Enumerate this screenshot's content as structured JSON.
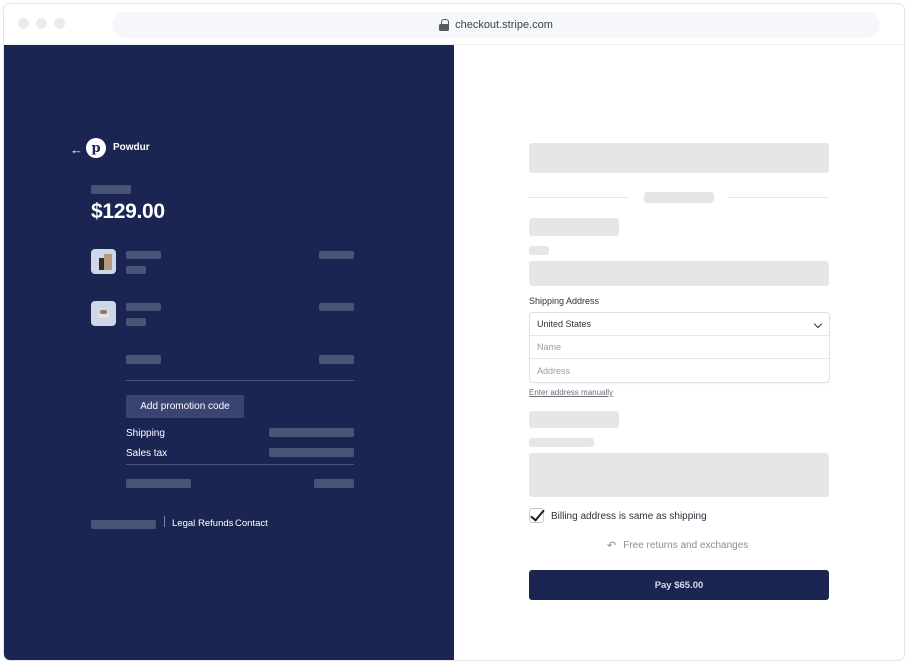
{
  "browser": {
    "url": "checkout.stripe.com",
    "lock_icon": "lock-icon"
  },
  "summary": {
    "back_icon": "arrow-left-icon",
    "back_glyph": "←",
    "logo_letter": "p",
    "brand_name": "Powdur",
    "total": "$129.00",
    "promo_button": "Add promotion code",
    "shipping_label": "Shipping",
    "sales_tax_label": "Sales tax",
    "footer_links": [
      "Legal",
      "Refunds",
      "Contact"
    ]
  },
  "payment": {
    "shipping_address_label": "Shipping Address",
    "country_value": "United States",
    "name_placeholder": "Name",
    "address_placeholder": "Address",
    "manual_link": "Enter address manually",
    "billing_same_label": "Billing address is same as shipping",
    "billing_same_checked": true,
    "returns_text": "Free returns and exchanges",
    "returns_icon": "return-arrow-icon",
    "returns_glyph": "↶",
    "pay_button": "Pay $65.00"
  },
  "colors": {
    "left_panel_bg": "#1b2552",
    "skeleton_dark": "#4a5478",
    "skeleton_light": "#e6e6e6",
    "pay_button_bg": "#1b2552"
  }
}
